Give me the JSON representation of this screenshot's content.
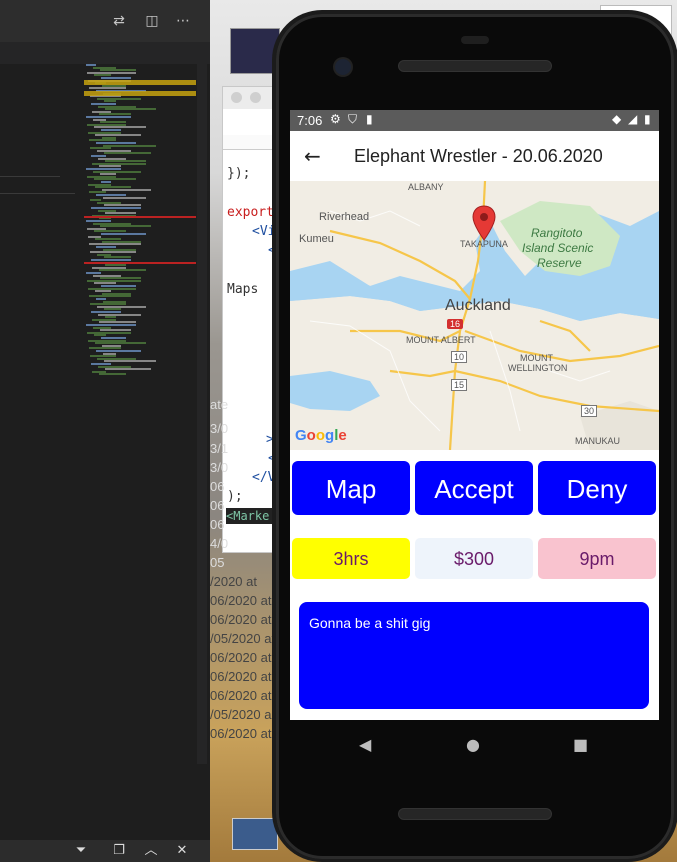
{
  "code_window": {
    "lines": [
      "});",
      "export",
      "<Vi",
      "<",
      "Maps",
      ">",
      "<",
      "</V",
      ");",
      "<Marke"
    ]
  },
  "background_list": {
    "items": [
      "/2020 at",
      "06/2020 at",
      "06/2020 at",
      "06/2020 at",
      "/05/2020 at",
      "06/2020 at",
      "06/2020 at",
      "06/2020 at",
      "/05/2020 a",
      "06/2020 at"
    ],
    "top_items": [
      "ate",
      "3/0",
      "3/1",
      "3/0",
      "06",
      "06",
      "06",
      "4/0",
      "05"
    ]
  },
  "phone": {
    "status": {
      "time": "7:06"
    },
    "appbar": {
      "title": "Elephant Wrestler - 20.06.2020",
      "back_icon": "arrow-back-icon"
    },
    "map": {
      "labels": {
        "albany": "ALBANY",
        "riverhead": "Riverhead",
        "kumeu": "Kumeu",
        "takapuna": "TAKAPUNA",
        "rangitoto": "Rangitoto",
        "island_scenic": "Island Scenic",
        "reserve": "Reserve",
        "auckland": "Auckland",
        "mount_albert": "MOUNT ALBERT",
        "mount": "MOUNT",
        "wellington": "WELLINGTON",
        "manukau": "MANUKAU",
        "route_16": "16",
        "route_10": "10",
        "route_15": "15",
        "route_30": "30"
      },
      "attribution": "Google"
    },
    "buttons": {
      "map": "Map",
      "accept": "Accept",
      "deny": "Deny"
    },
    "info": {
      "duration": "3hrs",
      "pay": "$300",
      "time": "9pm"
    },
    "note": "Gonna be a shit gig"
  },
  "colors": {
    "button_blue": "#0000ff",
    "duration_bg": "#ffff00",
    "pay_bg": "#eef4fb",
    "time_bg": "#f9c3cf",
    "info_text": "#6a1b6a"
  }
}
